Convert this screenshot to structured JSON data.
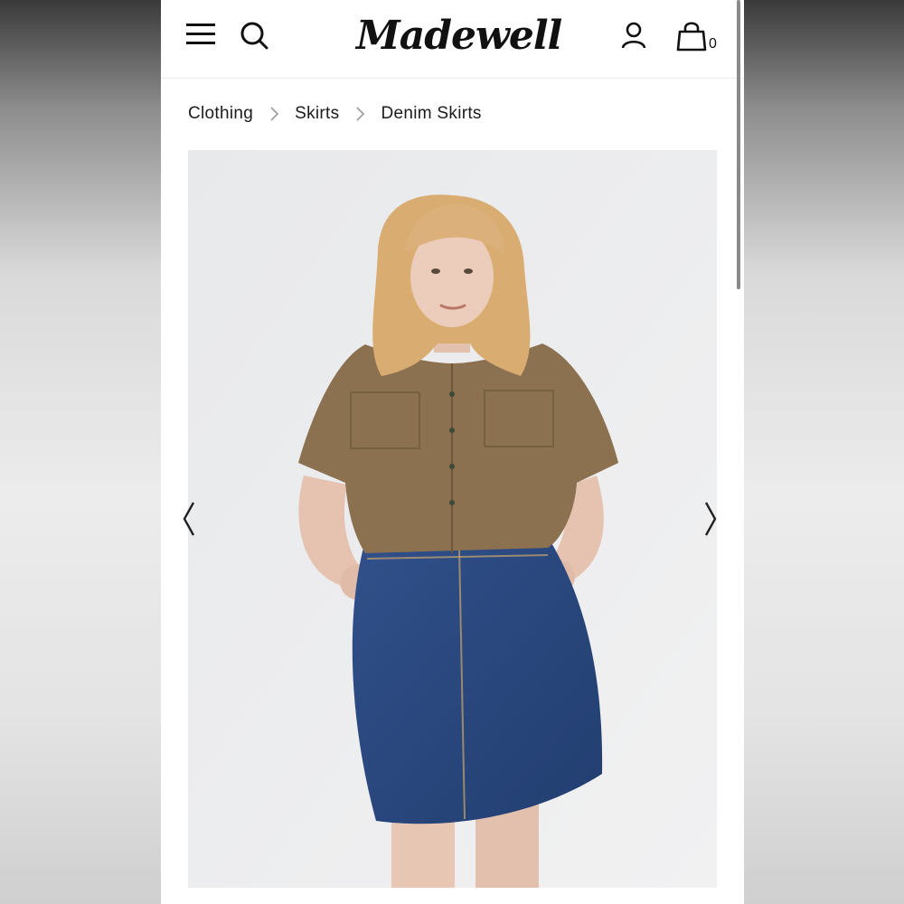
{
  "header": {
    "logo_text": "Madewell",
    "bag_count": "0",
    "icons": [
      "menu-icon",
      "search-icon",
      "account-icon",
      "shopping-bag-icon"
    ]
  },
  "breadcrumb": {
    "items": [
      "Clothing",
      "Skirts",
      "Denim Skirts"
    ]
  },
  "gallery": {
    "icons": [
      "chevron-left-icon",
      "chevron-right-icon"
    ]
  },
  "colors": {
    "text": "#111111",
    "photo_background": "#ebecee",
    "shirt": "#8b7150",
    "denim": "#2a4a7e",
    "hair": "#d9ad72"
  }
}
